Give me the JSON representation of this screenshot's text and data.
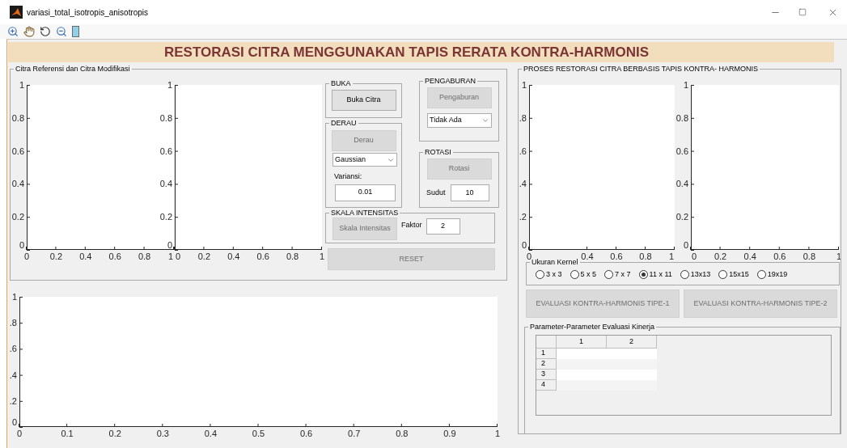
{
  "window": {
    "title": "variasi_total_isotropis_anisotropis"
  },
  "banner": "RESTORASI CITRA MENGGUNAKAN TAPIS RERATA KONTRA-HARMONIS",
  "left_panel": {
    "title": "Citra Referensi dan Citra Modifikasi",
    "axes": [
      {
        "chart_data": {
          "type": "line",
          "xlim": [
            0,
            1
          ],
          "ylim": [
            0,
            1
          ],
          "xticks": [
            0,
            0.2,
            0.4,
            0.6,
            0.8,
            1
          ],
          "yticks": [
            0,
            0.2,
            0.4,
            0.6,
            0.8,
            1
          ]
        }
      },
      {
        "chart_data": {
          "type": "line",
          "xlim": [
            0,
            1
          ],
          "ylim": [
            0,
            1
          ],
          "xticks": [
            0,
            0.2,
            0.4,
            0.6,
            0.8,
            1
          ],
          "yticks": [
            0,
            0.2,
            0.4,
            0.6,
            0.8,
            1
          ]
        }
      }
    ]
  },
  "controls": {
    "buka": {
      "title": "BUKA",
      "button": {
        "label": "Buka Citra",
        "disabled": false
      }
    },
    "derau": {
      "title": "DERAU",
      "button": {
        "label": "Derau",
        "disabled": true
      },
      "dropdown": {
        "value": "Gaussian"
      },
      "field_label": "Variansi:",
      "field": {
        "value": "0.01"
      }
    },
    "pengaburan": {
      "title": "PENGABURAN",
      "button": {
        "label": "Pengaburan",
        "disabled": true
      },
      "dropdown": {
        "value": "Tidak Ada"
      }
    },
    "rotasi": {
      "title": "ROTASI",
      "button": {
        "label": "Rotasi",
        "disabled": true
      },
      "field_label": "Sudut",
      "field": {
        "value": "10"
      }
    },
    "skala": {
      "title": "SKALA INTENSITAS",
      "button": {
        "label": "Skala Intensitas",
        "disabled": true
      },
      "field_label": "Faktor",
      "field": {
        "value": "2"
      }
    },
    "reset": {
      "label": "RESET",
      "disabled": true
    }
  },
  "bottom_axes": {
    "chart_data": {
      "type": "line",
      "xlim": [
        0,
        1
      ],
      "ylim": [
        0,
        1
      ],
      "xticks": [
        0,
        0.1,
        0.2,
        0.3,
        0.4,
        0.5,
        0.6,
        0.7,
        0.8,
        0.9,
        1
      ],
      "yticks": [
        0,
        {
          "value": 0.2,
          "label": ".2"
        },
        {
          "value": 0.4,
          "label": ".4"
        },
        {
          "value": 0.6,
          "label": ".6"
        },
        {
          "value": 0.8,
          "label": ".8"
        },
        1
      ]
    }
  },
  "right_panel": {
    "title": "PROSES RESTORASI CITRA BERBASIS TAPIS KONTRA- HARMONIS",
    "axes": [
      {
        "chart_data": {
          "type": "line",
          "xlim": [
            0,
            1
          ],
          "ylim": [
            0,
            1
          ],
          "xticks": [
            0,
            0.4,
            0.6,
            0.8,
            1
          ],
          "yticks": [
            0,
            {
              "value": 0.2,
              "label": ".2"
            },
            {
              "value": 0.4,
              "label": ".4"
            },
            {
              "value": 0.6,
              "label": ".6"
            },
            {
              "value": 0.8,
              "label": ".8"
            },
            1
          ]
        }
      },
      {
        "chart_data": {
          "type": "line",
          "xlim": [
            0,
            1
          ],
          "ylim": [
            0,
            1
          ],
          "xticks": [
            0,
            0.2,
            0.4,
            0.6,
            0.8,
            1
          ],
          "yticks": [
            0,
            0.2,
            0.4,
            0.6,
            0.8,
            1
          ]
        }
      }
    ],
    "kernel": {
      "title": "Ukuran Kernel",
      "options": [
        {
          "label": "3 x 3",
          "selected": false
        },
        {
          "label": "5 x 5",
          "selected": false
        },
        {
          "label": "7 x 7",
          "selected": false
        },
        {
          "label": "11 x 11",
          "selected": true
        },
        {
          "label": "13x13",
          "selected": false
        },
        {
          "label": "15x15",
          "selected": false
        },
        {
          "label": "19x19",
          "selected": false
        }
      ]
    },
    "buttons": [
      {
        "label": "EVALUASI  KONTRA-HARMONIS TIPE-1",
        "disabled": true
      },
      {
        "label": "EVALUASI  KONTRA-HARMONIS TIPE-2",
        "disabled": true
      }
    ],
    "table_panel": {
      "title": "Parameter-Parameter Evaluasi Kinerja",
      "columns": [
        "1",
        "2"
      ],
      "rows": [
        "1",
        "2",
        "3",
        "4"
      ]
    }
  }
}
